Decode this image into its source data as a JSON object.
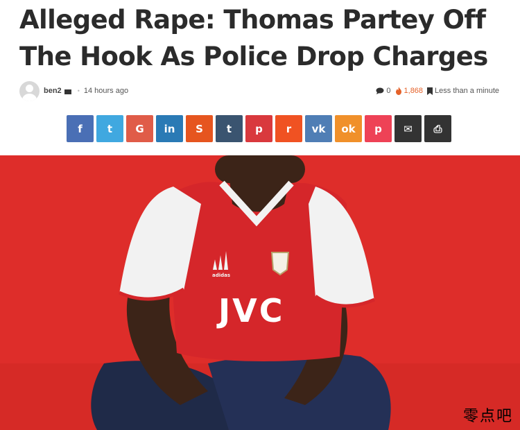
{
  "article": {
    "title": "Alleged Rape: Thomas Partey Off The Hook As Police Drop Charges",
    "author": "ben2",
    "time_ago": "14 hours ago",
    "comments": "0",
    "views": "1,868",
    "read_time": "Less than a minute"
  },
  "share": [
    {
      "icon": "facebook-icon",
      "glyph": "f",
      "color": "#4a6fb5"
    },
    {
      "icon": "twitter-icon",
      "glyph": "t",
      "color": "#40a8e0"
    },
    {
      "icon": "google-icon",
      "glyph": "G",
      "color": "#e05c48"
    },
    {
      "icon": "linkedin-icon",
      "glyph": "in",
      "color": "#2a7ab5"
    },
    {
      "icon": "stumbleupon-icon",
      "glyph": "S",
      "color": "#e6551f"
    },
    {
      "icon": "tumblr-icon",
      "glyph": "t",
      "color": "#3a5470"
    },
    {
      "icon": "pinterest-icon",
      "glyph": "p",
      "color": "#d9393d"
    },
    {
      "icon": "reddit-icon",
      "glyph": "r",
      "color": "#f05222"
    },
    {
      "icon": "vk-icon",
      "glyph": "vk",
      "color": "#4f7eb5"
    },
    {
      "icon": "odnoklassniki-icon",
      "glyph": "ok",
      "color": "#f0902a"
    },
    {
      "icon": "pocket-icon",
      "glyph": "p",
      "color": "#ee4256"
    },
    {
      "icon": "email-icon",
      "glyph": "✉",
      "color": "#333333"
    },
    {
      "icon": "print-icon",
      "glyph": "⎙",
      "color": "#333333"
    }
  ],
  "hero": {
    "shirt_text": "JVC",
    "brand": "adidas",
    "background": "#de2d2a"
  },
  "watermark": "零点吧"
}
